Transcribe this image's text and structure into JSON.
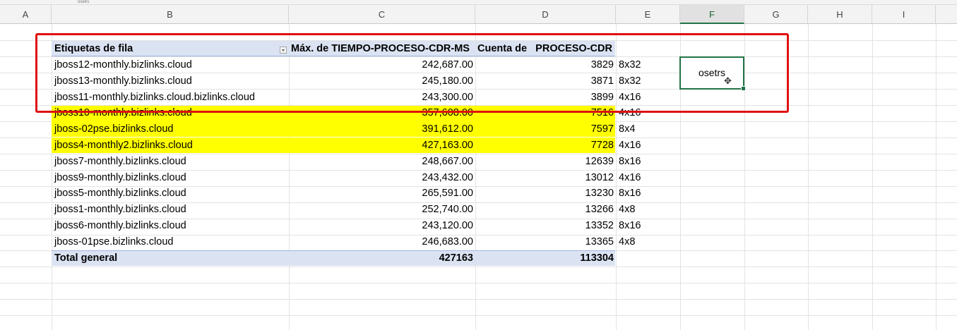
{
  "formula_bar": {
    "value": "osetrs"
  },
  "columns": [
    "A",
    "B",
    "C",
    "D",
    "E",
    "F",
    "G",
    "H",
    "I"
  ],
  "selected_column": "F",
  "pivot": {
    "headers": {
      "row_labels": "Etiquetas de fila",
      "max_time": "Máx. de TIEMPO-PROCESO-CDR-MS",
      "count": "Cuenta de   PROCESO-CDR"
    },
    "rows": [
      {
        "label": "jboss12-monthly.bizlinks.cloud",
        "max": "242,687.00",
        "count": "3829",
        "spec": "8x32",
        "highlight": false
      },
      {
        "label": "jboss13-monthly.bizlinks.cloud",
        "max": "245,180.00",
        "count": "3871",
        "spec": "8x32",
        "highlight": false
      },
      {
        "label": "jboss11-monthly.bizlinks.cloud.bizlinks.cloud",
        "max": "243,300.00",
        "count": "3899",
        "spec": "4x16",
        "highlight": false
      },
      {
        "label": "jboss10-monthly.bizlinks.cloud",
        "max": "357,608.00",
        "count": "7516",
        "spec": "4x16",
        "highlight": true
      },
      {
        "label": "jboss-02pse.bizlinks.cloud",
        "max": "391,612.00",
        "count": "7597",
        "spec": "8x4",
        "highlight": true
      },
      {
        "label": "jboss4-monthly2.bizlinks.cloud",
        "max": "427,163.00",
        "count": "7728",
        "spec": "4x16",
        "highlight": true
      },
      {
        "label": "jboss7-monthly.bizlinks.cloud",
        "max": "248,667.00",
        "count": "12639",
        "spec": "8x16",
        "highlight": false
      },
      {
        "label": "jboss9-monthly.bizlinks.cloud",
        "max": "243,432.00",
        "count": "13012",
        "spec": "4x16",
        "highlight": false
      },
      {
        "label": "jboss5-monthly.bizlinks.cloud",
        "max": "265,591.00",
        "count": "13230",
        "spec": "8x16",
        "highlight": false
      },
      {
        "label": "jboss1-monthly.bizlinks.cloud",
        "max": "252,740.00",
        "count": "13266",
        "spec": "4x8",
        "highlight": false
      },
      {
        "label": "jboss6-monthly.bizlinks.cloud",
        "max": "243,120.00",
        "count": "13352",
        "spec": "8x16",
        "highlight": false
      },
      {
        "label": "jboss-01pse.bizlinks.cloud",
        "max": "246,683.00",
        "count": "13365",
        "spec": "4x8",
        "highlight": false
      }
    ],
    "total": {
      "label": "Total general",
      "max": "427163",
      "count": "113304"
    }
  },
  "selected_cell": {
    "text": "osetrs"
  },
  "colors": {
    "highlight": "#ffff00",
    "pivot_header": "#dbe3f3",
    "annotation": "#e01010",
    "selection": "#217346"
  },
  "icons": {
    "cursor": "move-cursor-icon"
  }
}
